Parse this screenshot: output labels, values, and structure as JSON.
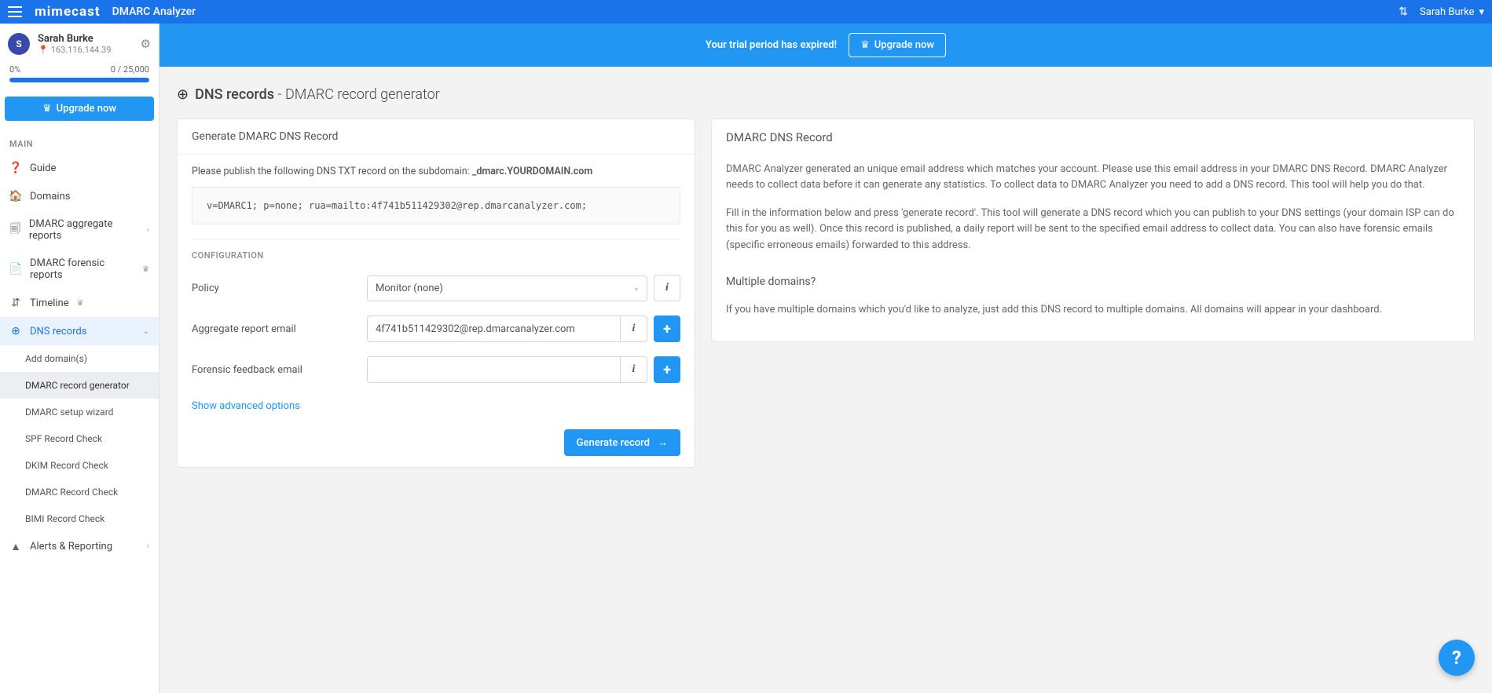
{
  "top": {
    "logo": "mimecast",
    "app_title": "DMARC Analyzer",
    "username": "Sarah Burke"
  },
  "sidebar": {
    "user_name": "Sarah Burke",
    "user_avatar_letter": "S",
    "user_ip": "163.116.144.39",
    "quota_pct": "0%",
    "quota_used": "0 / 25,000",
    "upgrade_label": "Upgrade now",
    "section_main": "MAIN",
    "nav": {
      "guide": "Guide",
      "domains": "Domains",
      "agg_reports": "DMARC aggregate reports",
      "forensic_reports": "DMARC forensic reports",
      "timeline": "Timeline",
      "dns_records": "DNS records",
      "alerts": "Alerts & Reporting"
    },
    "sub": {
      "add_domains": "Add domain(s)",
      "record_gen": "DMARC record generator",
      "setup_wiz": "DMARC setup wizard",
      "spf": "SPF Record Check",
      "dkim": "DKIM Record Check",
      "dmarc_check": "DMARC Record Check",
      "bimi": "BIMI Record Check"
    }
  },
  "banner": {
    "text": "Your trial period has expired!",
    "button": "Upgrade now"
  },
  "page": {
    "title_strong": "DNS records",
    "title_light": " - DMARC record generator",
    "left_header": "Generate DMARC DNS Record",
    "instruction_pre": "Please publish the following DNS TXT record on the subdomain: ",
    "instruction_sub": "_dmarc.YOURDOMAIN.com",
    "record_text": "v=DMARC1; p=none; rua=mailto:4f741b511429302@rep.dmarcanalyzer.com;",
    "config_label": "CONFIGURATION",
    "policy_label": "Policy",
    "policy_value": "Monitor (none)",
    "agg_label": "Aggregate report email",
    "agg_value": "4f741b511429302@rep.dmarcanalyzer.com",
    "forensic_label": "Forensic feedback email",
    "forensic_value": "",
    "adv_link": "Show advanced options",
    "gen_button": "Generate record",
    "right_header": "DMARC DNS Record",
    "right_p1": "DMARC Analyzer generated an unique email address which matches your account. Please use this email address in your DMARC DNS Record. DMARC Analyzer needs to collect data before it can generate any statistics. To collect data to DMARC Analyzer you need to add a DNS record. This tool will help you do that.",
    "right_p2": "Fill in the information below and press 'generate record'. This tool will generate a DNS record which you can publish to your DNS settings (your domain ISP can do this for you as well). Once this record is published, a daily report will be sent to the specified email address to collect data. You can also have forensic emails (specific erroneous emails) forwarded to this address.",
    "right_h2": "Multiple domains?",
    "right_p3": "If you have multiple domains which you'd like to analyze, just add this DNS record to multiple domains. All domains will appear in your dashboard."
  }
}
